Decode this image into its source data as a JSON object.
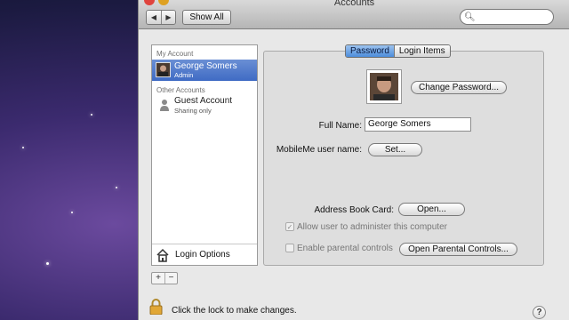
{
  "window": {
    "title": "Accounts",
    "nav_back": "◀",
    "nav_forward": "▶",
    "show_all": "Show All",
    "search_value": ""
  },
  "sidebar": {
    "my_account_header": "My Account",
    "current_user": {
      "name": "George Somers",
      "role": "Admin"
    },
    "other_accounts_header": "Other Accounts",
    "guest": {
      "name": "Guest Account",
      "status": "Sharing only"
    },
    "login_options": "Login Options"
  },
  "tabs": [
    {
      "label": "Password",
      "active": true
    },
    {
      "label": "Login Items",
      "active": false
    }
  ],
  "password_tab": {
    "change_password_button": "Change Password...",
    "full_name_label": "Full Name:",
    "full_name_value": "George Somers",
    "mobileme_label": "MobileMe user name:",
    "set_button": "Set...",
    "address_book_label": "Address Book Card:",
    "open_button": "Open...",
    "allow_admin_label": "Allow user to administer this computer",
    "allow_admin_checked": true,
    "parental_label": "Enable parental controls",
    "parental_checked": false,
    "open_parental_button": "Open Parental Controls..."
  },
  "footer": {
    "lock_text": "Click the lock to make changes.",
    "add_symbol": "+",
    "remove_symbol": "−",
    "help_symbol": "?"
  },
  "colors": {
    "selection": "#3f6bc4",
    "tab_active": "#4d8ddb"
  }
}
